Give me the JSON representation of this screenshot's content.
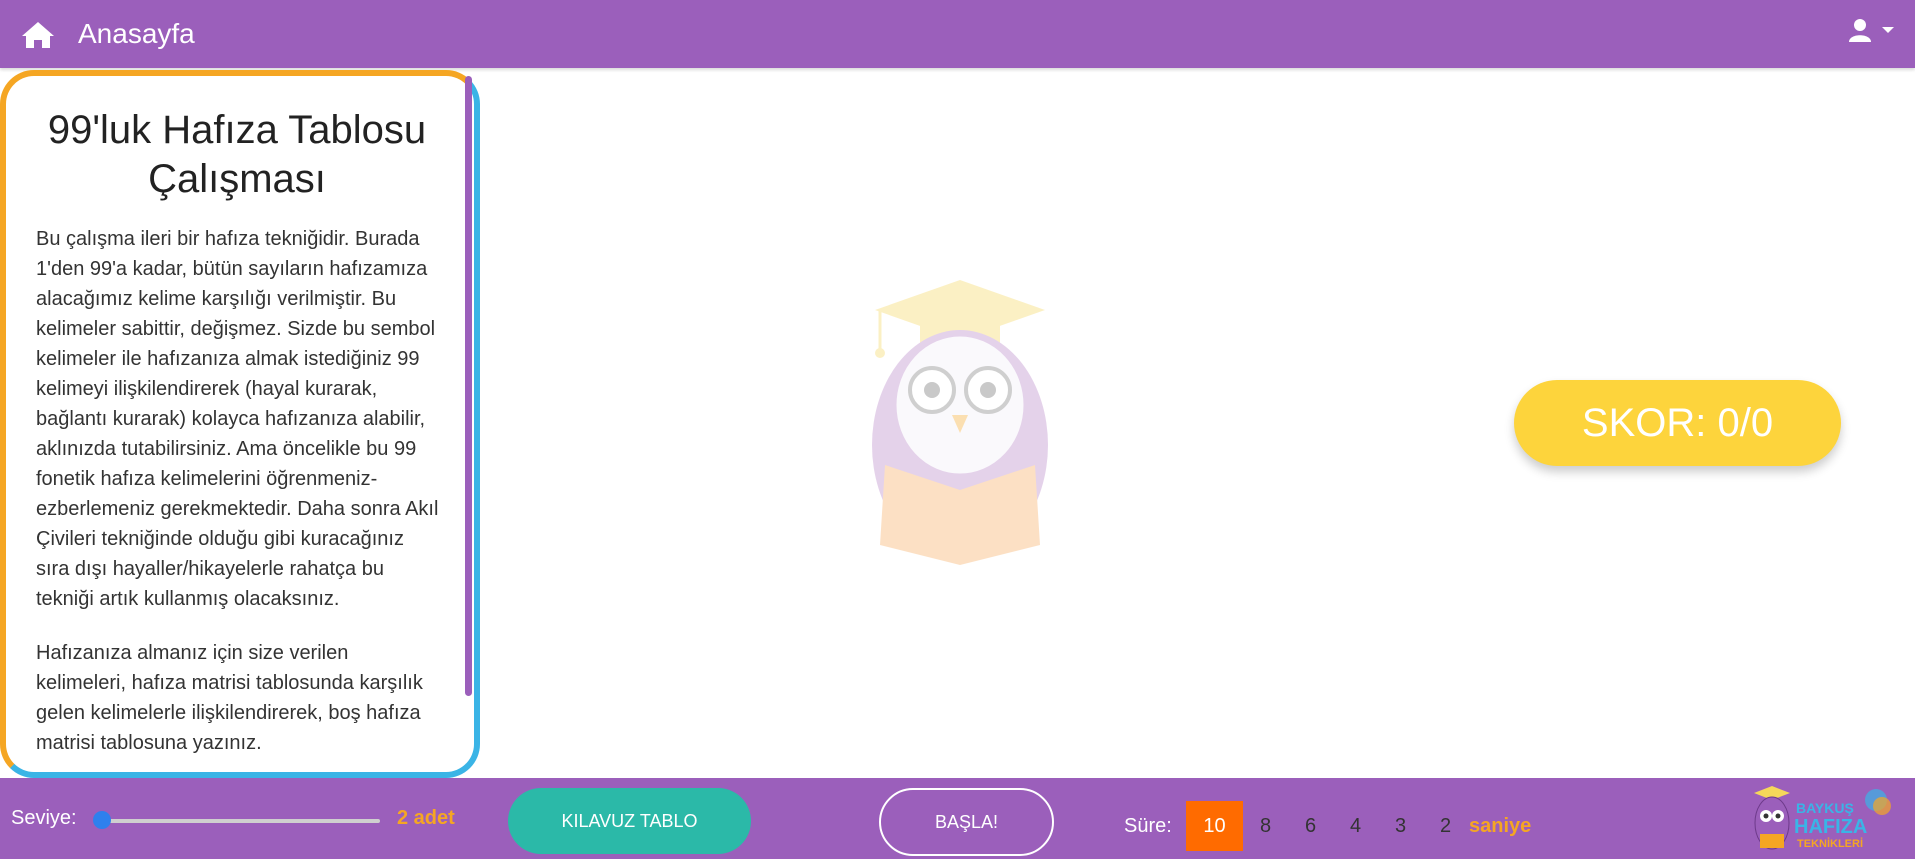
{
  "header": {
    "title": "Anasayfa",
    "icons": {
      "home": "home-icon",
      "user": "user-icon",
      "menu": "chevron-down-icon"
    }
  },
  "panel": {
    "title": "99'luk Hafıza Tablosu Çalışması",
    "paragraph1": "Bu çalışma ileri bir hafıza tekniğidir. Burada 1'den 99'a kadar, bütün sayıların hafızamıza alacağımız kelime karşılığı verilmiştir. Bu kelimeler sabittir, değişmez. Sizde bu sembol kelimeler ile hafızanıza almak istediğiniz 99 kelimeyi ilişkilendirerek (hayal kurarak, bağlantı kurarak) kolayca hafızanıza alabilir, aklınızda tutabilirsiniz. Ama öncelikle bu 99 fonetik hafıza kelimelerini öğrenmeniz-ezberlemeniz gerekmektedir. Daha sonra Akıl Çivileri tekniğinde olduğu gibi kuracağınız sıra dışı hayaller/hikayelerle rahatça bu tekniği artık kullanmış olacaksınız.",
    "paragraph2": "Hafızanıza almanız için size verilen kelimeleri, hafıza matrisi tablosunda karşılık gelen kelimelerle ilişkilendirerek, boş hafıza matrisi tablosuna yazınız."
  },
  "score": {
    "label": "SKOR: 0/0"
  },
  "footer": {
    "level_label": "Seviye:",
    "level_value": "2 adet",
    "level_slider": 0,
    "guide_button": "KILAVUZ TABLO",
    "start_button": "BAŞLA!",
    "time_label": "Süre:",
    "time_options": [
      "10",
      "8",
      "6",
      "4",
      "3",
      "2"
    ],
    "time_selected": "10",
    "time_unit": "saniye",
    "brand": {
      "line1": "BAYKUŞ",
      "line2": "HAFIZA",
      "line3": "TEKNİKLERİ"
    }
  },
  "colors": {
    "header_bg": "#9b5fbb",
    "accent_orange": "#f5a623",
    "accent_blue": "#3ab4e6",
    "score_bg": "#fdd43c",
    "guide_bg": "#2bb9a8",
    "time_active": "#ff6b00"
  }
}
